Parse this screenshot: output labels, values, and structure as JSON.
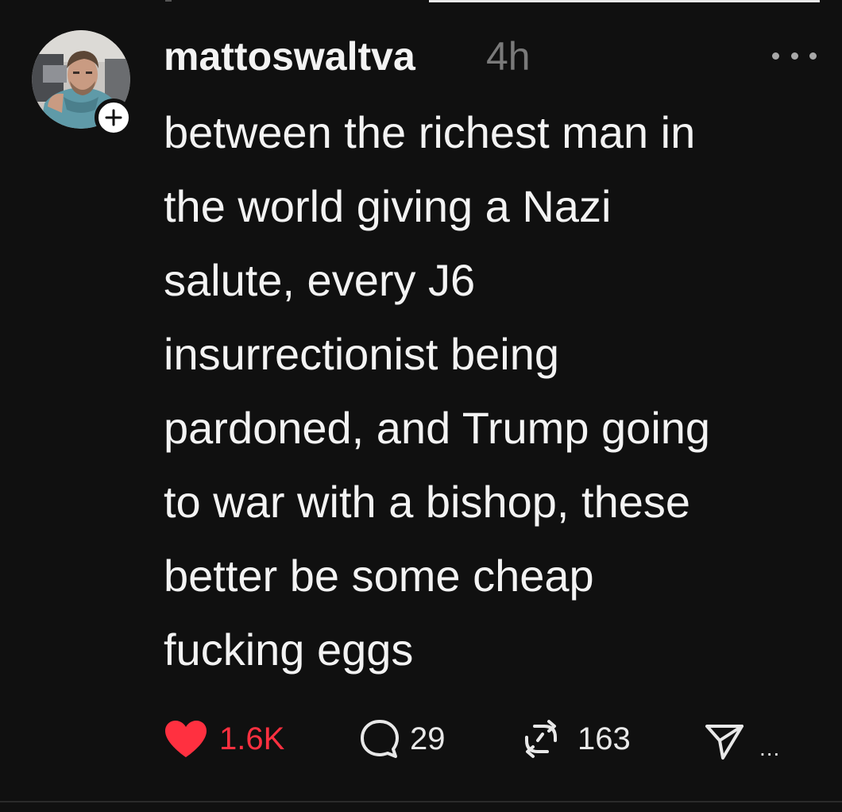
{
  "post": {
    "username": "mattoswaltva",
    "timestamp": "4h",
    "body_lines": [
      "between the richest man in",
      "the world giving a Nazi",
      "salute, every J6",
      "insurrectionist being",
      "pardoned, and Trump going",
      "to war with a bishop, these",
      "better be some cheap",
      "fucking eggs"
    ],
    "actions": {
      "likes": "1.6K",
      "replies": "29",
      "reposts": "163",
      "share_more": "..."
    }
  },
  "icons": {
    "avatar": "user-avatar",
    "follow": "plus-icon",
    "more": "more-options-icon",
    "like": "heart-icon",
    "reply": "comment-bubble-icon",
    "repost": "repost-icon",
    "share": "send-icon"
  },
  "colors": {
    "background": "#101010",
    "text": "#f3f3f3",
    "muted": "#7a7a7a",
    "like": "#ff3040"
  }
}
